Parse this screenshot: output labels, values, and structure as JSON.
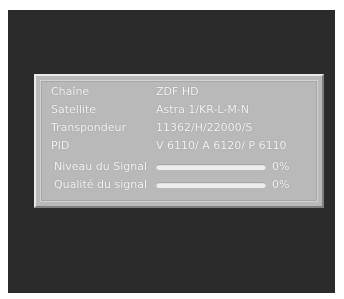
{
  "channel_info": {
    "rows": [
      {
        "label": "Chaîne",
        "value": "ZDF HD"
      },
      {
        "label": "Satellite",
        "value": "Astra 1/KR-L-M-N"
      },
      {
        "label": "Transpondeur",
        "value": "11362/H/22000/S"
      },
      {
        "label": "PID",
        "value": "V 6110/ A 6120/ P 6110"
      }
    ],
    "signal_level": {
      "label": "Niveau du Signal",
      "percent_text": "0%",
      "fraction": 0
    },
    "signal_quality": {
      "label": "Qualité du signal",
      "percent_text": "0%",
      "fraction": 0
    }
  },
  "colors": {
    "screen_background": "#2b2b2b",
    "panel_background": "#b9b9b9",
    "text": "#f3f3f3"
  }
}
